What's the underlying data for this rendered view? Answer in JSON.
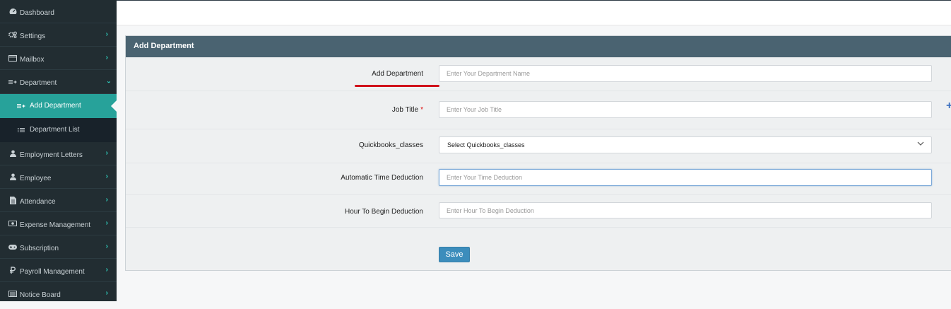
{
  "sidebar": {
    "items": [
      {
        "label": "Dashboard",
        "icon": "dashboard-icon"
      },
      {
        "label": "Settings",
        "icon": "cogs-icon"
      },
      {
        "label": "Mailbox",
        "icon": "mailbox-icon"
      },
      {
        "label": "Department",
        "icon": "department-icon"
      },
      {
        "label": "Employment Letters",
        "icon": "user-icon"
      },
      {
        "label": "Employee",
        "icon": "user-icon"
      },
      {
        "label": "Attendance",
        "icon": "file-icon"
      },
      {
        "label": "Expense Management",
        "icon": "money-icon"
      },
      {
        "label": "Subscription",
        "icon": "gamepad-icon"
      },
      {
        "label": "Payroll Management",
        "icon": "ruble-icon"
      },
      {
        "label": "Notice Board",
        "icon": "newspaper-icon"
      }
    ],
    "department_sub": [
      {
        "label": "Add Department",
        "icon": "add-list-icon",
        "active": true
      },
      {
        "label": "Department List",
        "icon": "list-icon",
        "active": false
      }
    ]
  },
  "form": {
    "title": "Add Department",
    "fields": {
      "department": {
        "label": "Add Department",
        "placeholder": "Enter Your Department Name"
      },
      "job_title": {
        "label": "Job Title",
        "required_mark": "*",
        "placeholder": "Enter Your Job Title"
      },
      "quickbooks": {
        "label": "Quickbooks_classes",
        "selected": "Select Quickbooks_classes"
      },
      "time_deduction": {
        "label": "Automatic Time Deduction",
        "placeholder": "Enter Your Time Deduction"
      },
      "begin_deduction": {
        "label": "Hour To Begin Deduction",
        "placeholder": "Enter Hour To Begin Deduction"
      }
    },
    "save_label": "Save",
    "add_job_title_symbol": "+"
  },
  "colors": {
    "sidebar_bg": "#222d32",
    "active_item": "#27a29a",
    "panel_header": "#4a6371",
    "primary_button": "#3c8dbc",
    "chevron": "#2fd0c0",
    "highlight_underline": "#d0121b"
  }
}
